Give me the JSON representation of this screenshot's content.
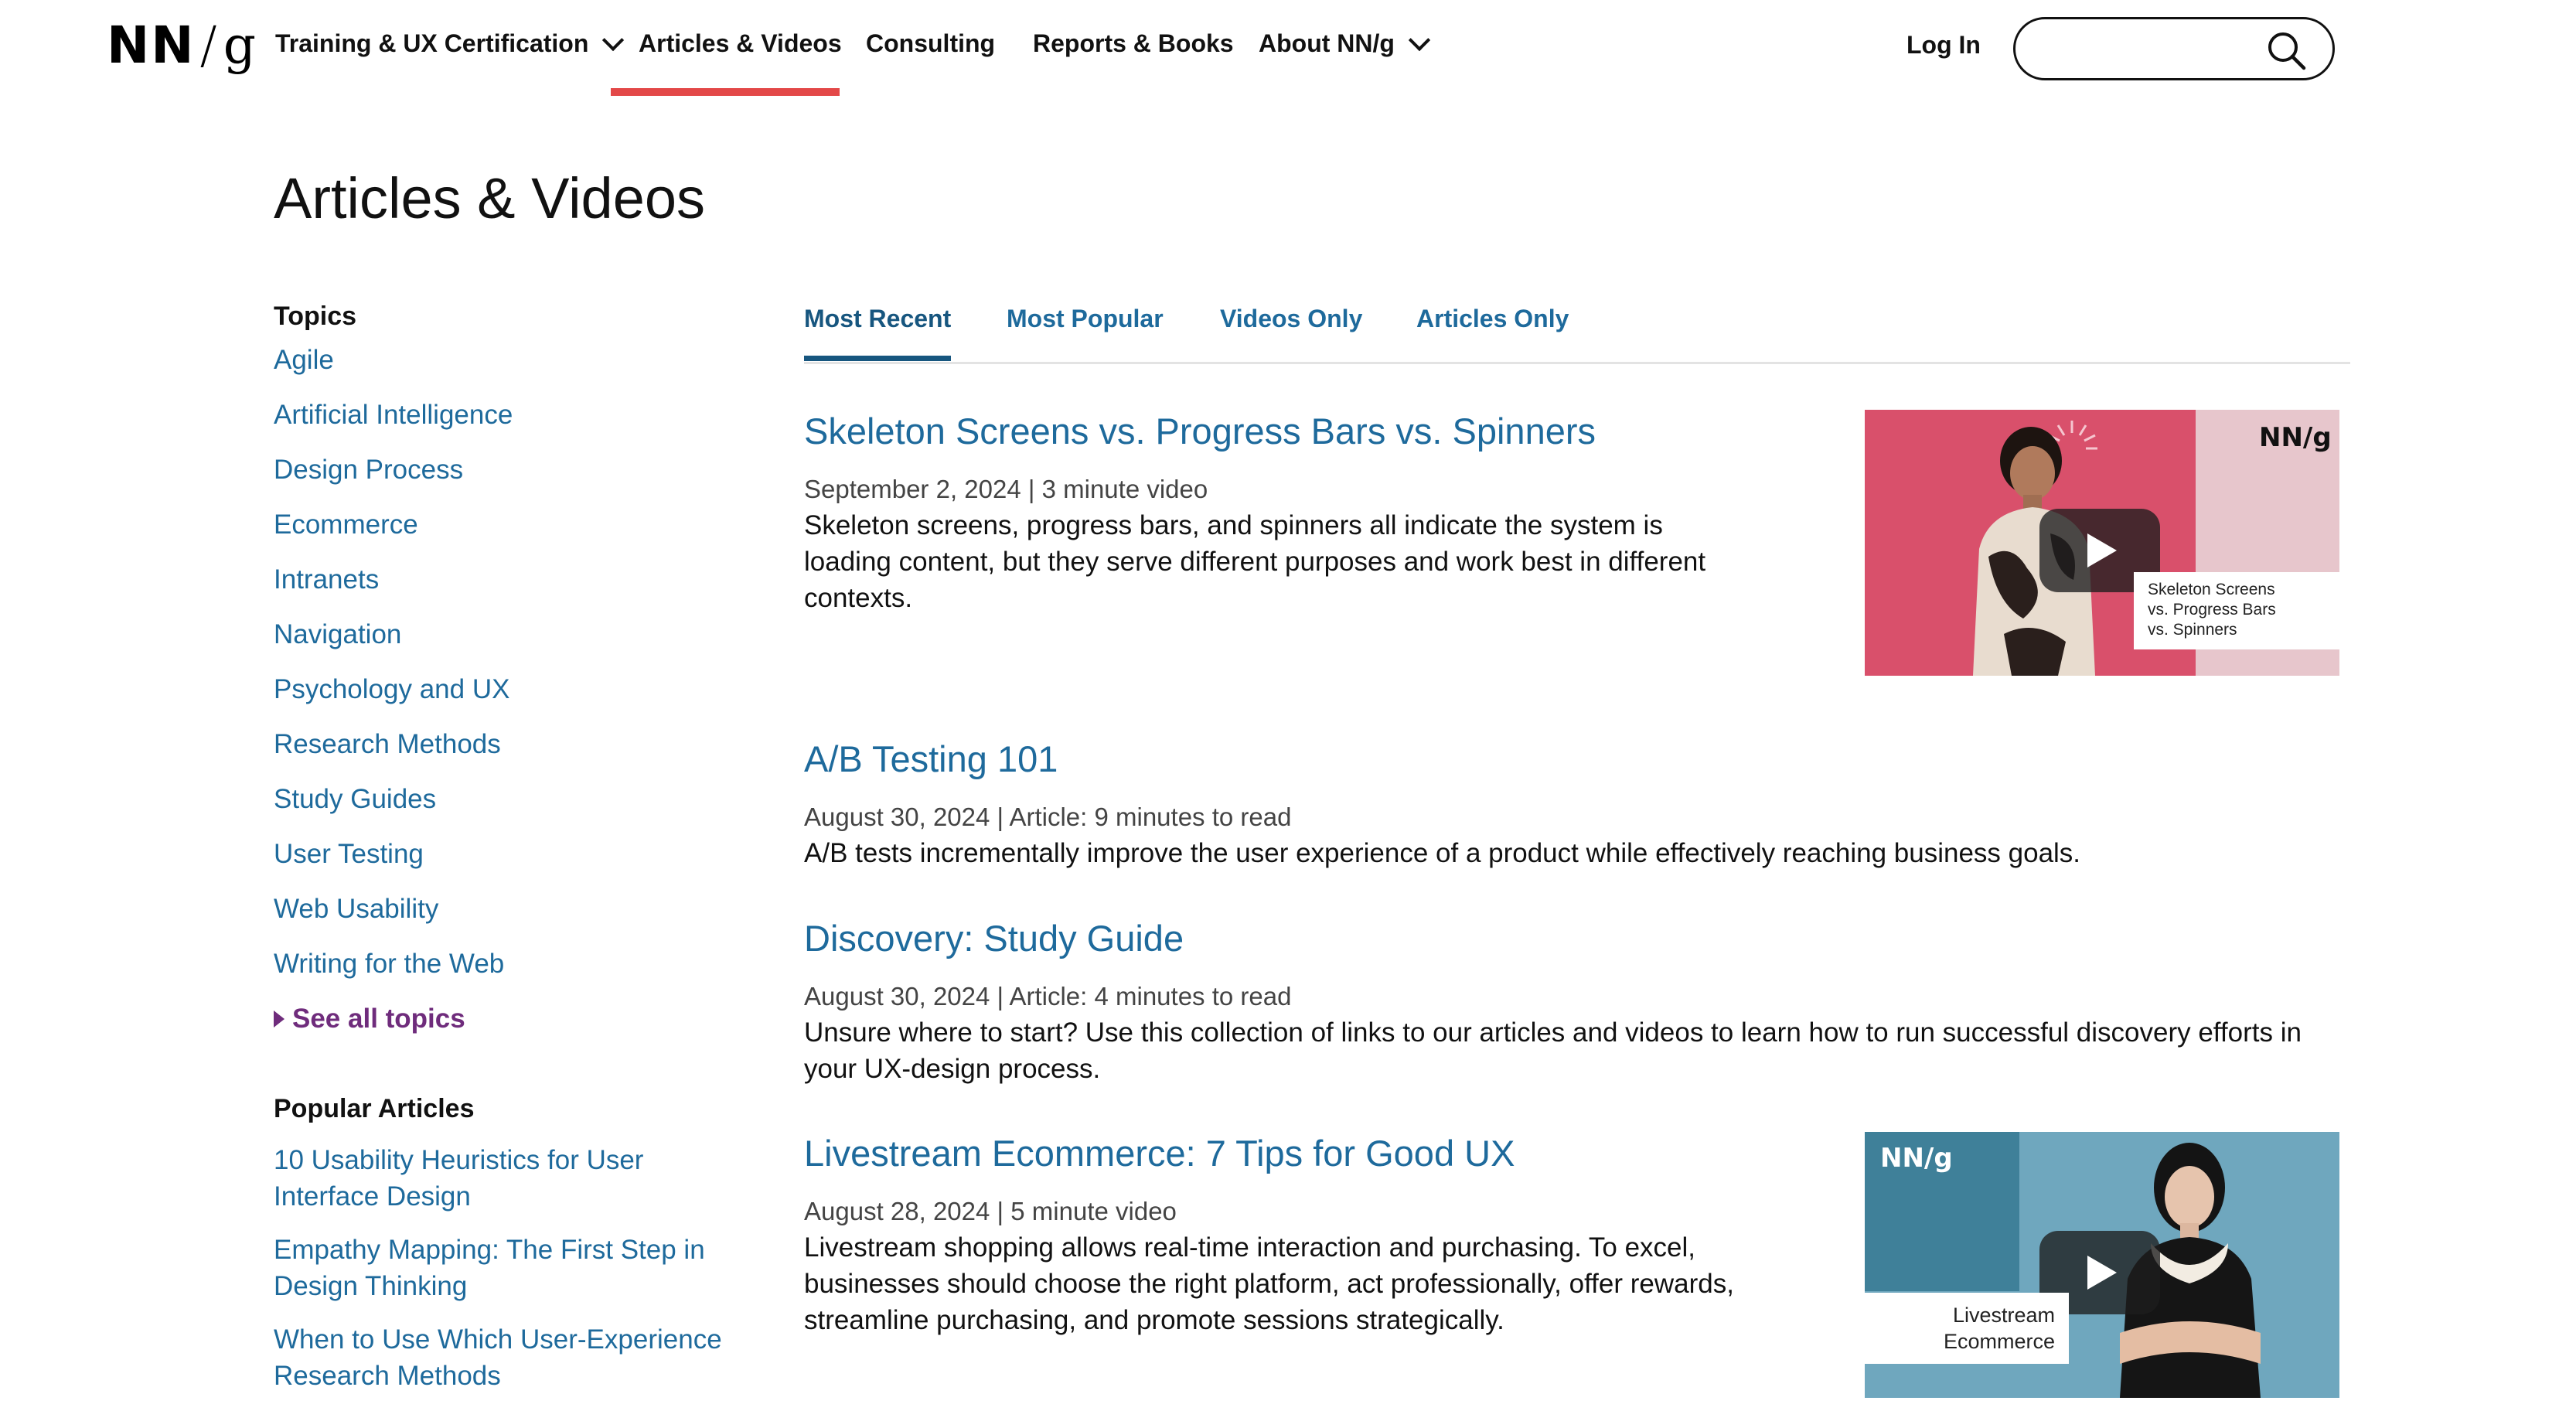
{
  "logo": {
    "nn": "NN",
    "slash": "/",
    "g": "g"
  },
  "nav": {
    "items": [
      {
        "label": "Training & UX Certification",
        "dropdown": true
      },
      {
        "label": "Articles & Videos",
        "dropdown": false,
        "active": true
      },
      {
        "label": "Consulting",
        "dropdown": false
      },
      {
        "label": "Reports & Books",
        "dropdown": false
      },
      {
        "label": "About NN/g",
        "dropdown": true
      }
    ],
    "login_label": "Log In",
    "search_value": "",
    "accent_color": "#e34848"
  },
  "page_title": "Articles & Videos",
  "sidebar": {
    "topics_heading": "Topics",
    "topics": [
      "Agile",
      "Artificial Intelligence",
      "Design Process",
      "Ecommerce",
      "Intranets",
      "Navigation",
      "Psychology and UX",
      "Research Methods",
      "Study Guides",
      "User Testing",
      "Web Usability",
      "Writing for the Web"
    ],
    "see_all": "See all topics",
    "popular_heading": "Popular Articles",
    "popular": [
      "10 Usability Heuristics for User Interface Design",
      "Empathy Mapping: The First Step in Design Thinking",
      "When to Use Which User-Experience Research Methods"
    ]
  },
  "tabs": [
    {
      "label": "Most Recent",
      "active": true
    },
    {
      "label": "Most Popular",
      "active": false
    },
    {
      "label": "Videos Only",
      "active": false
    },
    {
      "label": "Articles Only",
      "active": false
    }
  ],
  "articles": [
    {
      "title": "Skeleton Screens vs. Progress Bars vs. Spinners",
      "meta": "September 2, 2024 | 3 minute video",
      "desc": "Skeleton screens, progress bars, and spinners all indicate the system is loading content, but they serve different purposes and work best in different contexts.",
      "thumb_caption": [
        "Skeleton Screens",
        "vs. Progress Bars",
        "vs. Spinners"
      ],
      "thumb_logo": "NN/g"
    },
    {
      "title": "A/B Testing 101",
      "meta": "August 30, 2024 | Article: 9 minutes to read",
      "desc": "A/B tests incrementally improve the user experience of a product while effectively reaching business goals."
    },
    {
      "title": "Discovery: Study Guide",
      "meta": "August 30, 2024 | Article: 4 minutes to read",
      "desc": "Unsure where to start? Use this collection of links to our articles and videos to learn how to run successful discovery efforts in your UX-design process."
    },
    {
      "title": "Livestream Ecommerce: 7 Tips for Good UX",
      "meta": "August 28, 2024 | 5 minute video",
      "desc": "Livestream shopping allows real-time interaction and purchasing. To excel, businesses should choose the right platform, act professionally, offer rewards, streamline purchasing, and promote sessions strategically.",
      "thumb_caption": [
        "Livestream",
        "Ecommerce"
      ],
      "thumb_logo": "NN/g"
    }
  ]
}
